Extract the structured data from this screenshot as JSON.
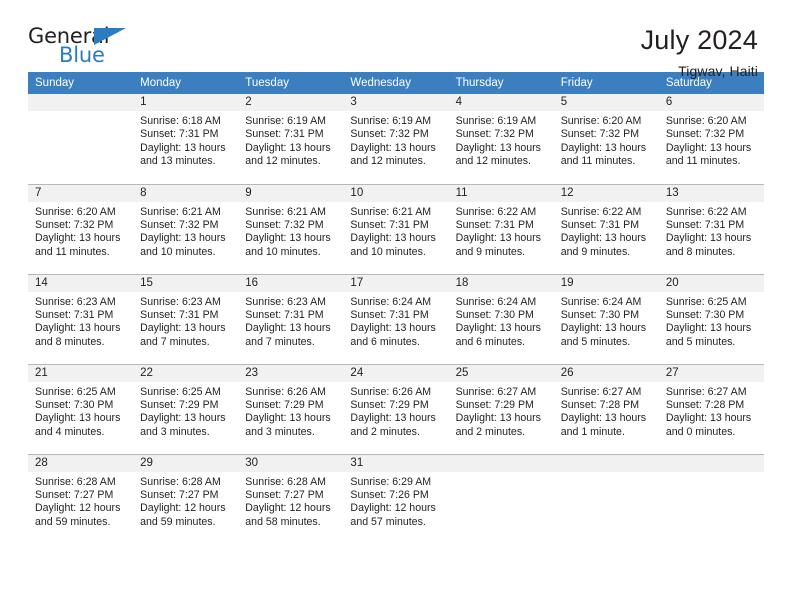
{
  "brand": {
    "word_one": "General",
    "word_two": "Blue",
    "triangle_icon": "triangle-icon",
    "accent_color": "#2b7cc0"
  },
  "header": {
    "title": "July 2024",
    "subtitle": "Tigwav, Haiti"
  },
  "calendar": {
    "header_bg": "#3c7fc1",
    "daynum_bg": "#f1f1f1",
    "weekday_headers": [
      "Sunday",
      "Monday",
      "Tuesday",
      "Wednesday",
      "Thursday",
      "Friday",
      "Saturday"
    ],
    "weeks": [
      [
        {
          "day": "",
          "lines": []
        },
        {
          "day": "1",
          "lines": [
            "Sunrise: 6:18 AM",
            "Sunset: 7:31 PM",
            "Daylight: 13 hours",
            "and 13 minutes."
          ]
        },
        {
          "day": "2",
          "lines": [
            "Sunrise: 6:19 AM",
            "Sunset: 7:31 PM",
            "Daylight: 13 hours",
            "and 12 minutes."
          ]
        },
        {
          "day": "3",
          "lines": [
            "Sunrise: 6:19 AM",
            "Sunset: 7:32 PM",
            "Daylight: 13 hours",
            "and 12 minutes."
          ]
        },
        {
          "day": "4",
          "lines": [
            "Sunrise: 6:19 AM",
            "Sunset: 7:32 PM",
            "Daylight: 13 hours",
            "and 12 minutes."
          ]
        },
        {
          "day": "5",
          "lines": [
            "Sunrise: 6:20 AM",
            "Sunset: 7:32 PM",
            "Daylight: 13 hours",
            "and 11 minutes."
          ]
        },
        {
          "day": "6",
          "lines": [
            "Sunrise: 6:20 AM",
            "Sunset: 7:32 PM",
            "Daylight: 13 hours",
            "and 11 minutes."
          ]
        }
      ],
      [
        {
          "day": "7",
          "lines": [
            "Sunrise: 6:20 AM",
            "Sunset: 7:32 PM",
            "Daylight: 13 hours",
            "and 11 minutes."
          ]
        },
        {
          "day": "8",
          "lines": [
            "Sunrise: 6:21 AM",
            "Sunset: 7:32 PM",
            "Daylight: 13 hours",
            "and 10 minutes."
          ]
        },
        {
          "day": "9",
          "lines": [
            "Sunrise: 6:21 AM",
            "Sunset: 7:32 PM",
            "Daylight: 13 hours",
            "and 10 minutes."
          ]
        },
        {
          "day": "10",
          "lines": [
            "Sunrise: 6:21 AM",
            "Sunset: 7:31 PM",
            "Daylight: 13 hours",
            "and 10 minutes."
          ]
        },
        {
          "day": "11",
          "lines": [
            "Sunrise: 6:22 AM",
            "Sunset: 7:31 PM",
            "Daylight: 13 hours",
            "and 9 minutes."
          ]
        },
        {
          "day": "12",
          "lines": [
            "Sunrise: 6:22 AM",
            "Sunset: 7:31 PM",
            "Daylight: 13 hours",
            "and 9 minutes."
          ]
        },
        {
          "day": "13",
          "lines": [
            "Sunrise: 6:22 AM",
            "Sunset: 7:31 PM",
            "Daylight: 13 hours",
            "and 8 minutes."
          ]
        }
      ],
      [
        {
          "day": "14",
          "lines": [
            "Sunrise: 6:23 AM",
            "Sunset: 7:31 PM",
            "Daylight: 13 hours",
            "and 8 minutes."
          ]
        },
        {
          "day": "15",
          "lines": [
            "Sunrise: 6:23 AM",
            "Sunset: 7:31 PM",
            "Daylight: 13 hours",
            "and 7 minutes."
          ]
        },
        {
          "day": "16",
          "lines": [
            "Sunrise: 6:23 AM",
            "Sunset: 7:31 PM",
            "Daylight: 13 hours",
            "and 7 minutes."
          ]
        },
        {
          "day": "17",
          "lines": [
            "Sunrise: 6:24 AM",
            "Sunset: 7:31 PM",
            "Daylight: 13 hours",
            "and 6 minutes."
          ]
        },
        {
          "day": "18",
          "lines": [
            "Sunrise: 6:24 AM",
            "Sunset: 7:30 PM",
            "Daylight: 13 hours",
            "and 6 minutes."
          ]
        },
        {
          "day": "19",
          "lines": [
            "Sunrise: 6:24 AM",
            "Sunset: 7:30 PM",
            "Daylight: 13 hours",
            "and 5 minutes."
          ]
        },
        {
          "day": "20",
          "lines": [
            "Sunrise: 6:25 AM",
            "Sunset: 7:30 PM",
            "Daylight: 13 hours",
            "and 5 minutes."
          ]
        }
      ],
      [
        {
          "day": "21",
          "lines": [
            "Sunrise: 6:25 AM",
            "Sunset: 7:30 PM",
            "Daylight: 13 hours",
            "and 4 minutes."
          ]
        },
        {
          "day": "22",
          "lines": [
            "Sunrise: 6:25 AM",
            "Sunset: 7:29 PM",
            "Daylight: 13 hours",
            "and 3 minutes."
          ]
        },
        {
          "day": "23",
          "lines": [
            "Sunrise: 6:26 AM",
            "Sunset: 7:29 PM",
            "Daylight: 13 hours",
            "and 3 minutes."
          ]
        },
        {
          "day": "24",
          "lines": [
            "Sunrise: 6:26 AM",
            "Sunset: 7:29 PM",
            "Daylight: 13 hours",
            "and 2 minutes."
          ]
        },
        {
          "day": "25",
          "lines": [
            "Sunrise: 6:27 AM",
            "Sunset: 7:29 PM",
            "Daylight: 13 hours",
            "and 2 minutes."
          ]
        },
        {
          "day": "26",
          "lines": [
            "Sunrise: 6:27 AM",
            "Sunset: 7:28 PM",
            "Daylight: 13 hours",
            "and 1 minute."
          ]
        },
        {
          "day": "27",
          "lines": [
            "Sunrise: 6:27 AM",
            "Sunset: 7:28 PM",
            "Daylight: 13 hours",
            "and 0 minutes."
          ]
        }
      ],
      [
        {
          "day": "28",
          "lines": [
            "Sunrise: 6:28 AM",
            "Sunset: 7:27 PM",
            "Daylight: 12 hours",
            "and 59 minutes."
          ]
        },
        {
          "day": "29",
          "lines": [
            "Sunrise: 6:28 AM",
            "Sunset: 7:27 PM",
            "Daylight: 12 hours",
            "and 59 minutes."
          ]
        },
        {
          "day": "30",
          "lines": [
            "Sunrise: 6:28 AM",
            "Sunset: 7:27 PM",
            "Daylight: 12 hours",
            "and 58 minutes."
          ]
        },
        {
          "day": "31",
          "lines": [
            "Sunrise: 6:29 AM",
            "Sunset: 7:26 PM",
            "Daylight: 12 hours",
            "and 57 minutes."
          ]
        },
        {
          "day": "",
          "lines": []
        },
        {
          "day": "",
          "lines": []
        },
        {
          "day": "",
          "lines": []
        }
      ]
    ]
  }
}
